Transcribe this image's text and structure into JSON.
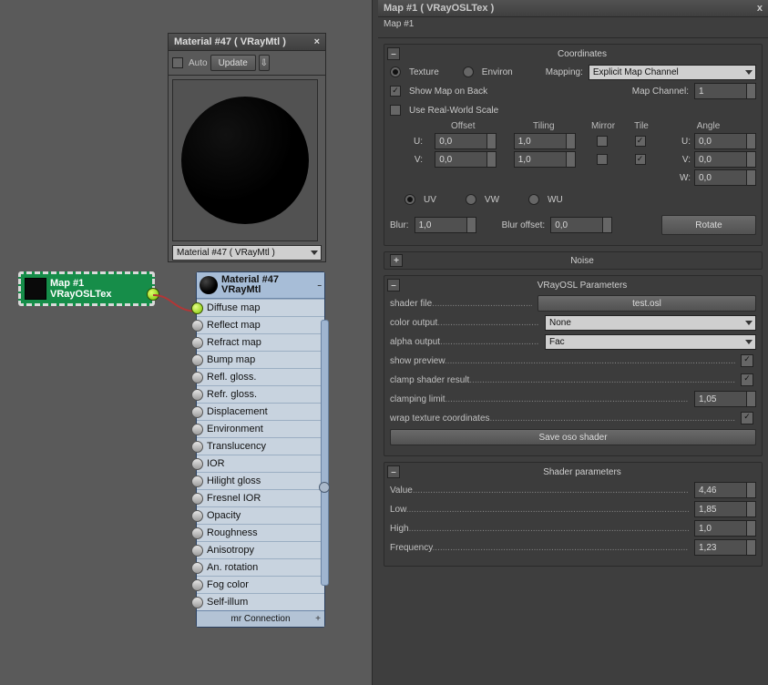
{
  "left": {
    "preview_title": "Material #47  ( VRayMtl )",
    "auto_label": "Auto",
    "update_label": "Update",
    "mat_dropdown": "Material #47  ( VRayMtl )"
  },
  "map_node": {
    "line1": "Map #1",
    "line2": "VRayOSLTex"
  },
  "mat_node": {
    "title1": "Material #47",
    "title2": "VRayMtl",
    "slots": [
      "Diffuse map",
      "Reflect map",
      "Refract map",
      "Bump map",
      "Refl. gloss.",
      "Refr. gloss.",
      "Displacement",
      "Environment",
      "Translucency",
      "IOR",
      "Hilight gloss",
      "Fresnel IOR",
      "Opacity",
      "Roughness",
      "Anisotropy",
      "An. rotation",
      "Fog color",
      "Self-illum"
    ],
    "footer": "mr Connection"
  },
  "right": {
    "window_title": "Map #1  ( VRayOSLTex )",
    "breadcrumb": "Map #1",
    "coordinates": {
      "title": "Coordinates",
      "texture": "Texture",
      "environ": "Environ",
      "mapping_lbl": "Mapping:",
      "mapping_val": "Explicit Map Channel",
      "show_map": "Show Map on Back",
      "map_channel_lbl": "Map Channel:",
      "map_channel_val": "1",
      "real_world": "Use Real-World Scale",
      "offset_h": "Offset",
      "tiling_h": "Tiling",
      "mirror_h": "Mirror",
      "tile_h": "Tile",
      "angle_h": "Angle",
      "u": "U:",
      "v": "V:",
      "w": "W:",
      "u_off": "0,0",
      "v_off": "0,0",
      "u_til": "1,0",
      "v_til": "1,0",
      "u_ang": "0,0",
      "v_ang": "0,0",
      "w_ang": "0,0",
      "uv": "UV",
      "vw": "VW",
      "wu": "WU",
      "blur_lbl": "Blur:",
      "blur_val": "1,0",
      "bluroff_lbl": "Blur offset:",
      "bluroff_val": "0,0",
      "rotate": "Rotate"
    },
    "noise_title": "Noise",
    "osl": {
      "title": "VRayOSL Parameters",
      "shader_file_lbl": "shader file",
      "shader_file_val": "test.osl",
      "color_out_lbl": "color output",
      "color_out_val": "None",
      "alpha_out_lbl": "alpha output",
      "alpha_out_val": "Fac",
      "show_preview": "show preview",
      "clamp_result": "clamp shader result",
      "clamp_limit_lbl": "clamping limit",
      "clamp_limit_val": "1,05",
      "wrap": "wrap texture coordinates",
      "save": "Save oso shader"
    },
    "shader": {
      "title": "Shader parameters",
      "value_lbl": "Value",
      "value": "4,46",
      "low_lbl": "Low",
      "low": "1,85",
      "high_lbl": "High",
      "high": "1,0",
      "freq_lbl": "Frequency",
      "freq": "1,23"
    }
  }
}
